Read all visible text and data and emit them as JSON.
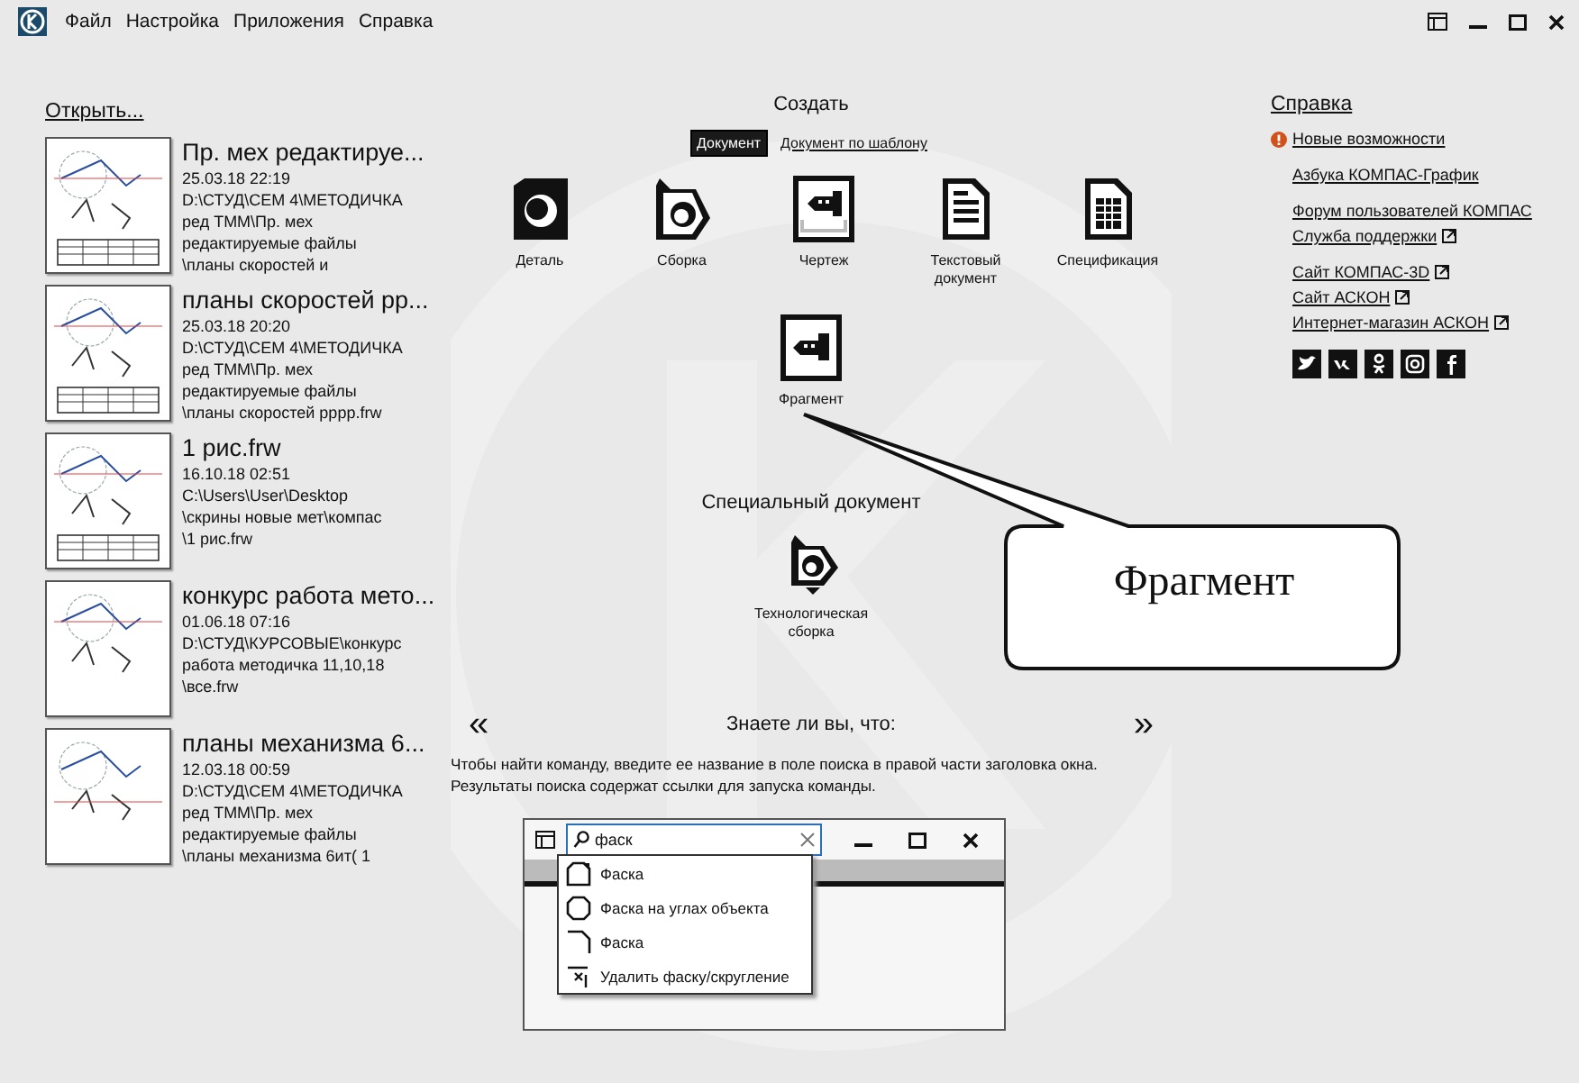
{
  "menu": [
    "Файл",
    "Настройка",
    "Приложения",
    "Справка"
  ],
  "recent": {
    "title": "Открыть...",
    "files": [
      {
        "name": "Пр. мех  редактируе...",
        "date": "25.03.18 22:19",
        "path": [
          "D:\\СТУД\\СЕМ 4\\МЕТОДИЧКА",
          "ред ТММ\\Пр. мех",
          "редактируемые файлы",
          "\\планы скоростей и"
        ]
      },
      {
        "name": "планы скоростей рр...",
        "date": "25.03.18 20:20",
        "path": [
          "D:\\СТУД\\СЕМ 4\\МЕТОДИЧКА",
          "ред ТММ\\Пр. мех",
          "редактируемые файлы",
          "\\планы скоростей рррр.frw"
        ]
      },
      {
        "name": "1 рис.frw",
        "date": "16.10.18 02:51",
        "path": [
          "C:\\Users\\User\\Desktop",
          "\\скрины новые мет\\компас",
          "\\1 рис.frw"
        ]
      },
      {
        "name": "конкурс работа мето...",
        "date": "01.06.18 07:16",
        "path": [
          "D:\\СТУД\\КУРСОВЫЕ\\конкурс",
          "работа методичка 11,10,18",
          "\\все.frw"
        ]
      },
      {
        "name": "планы механизма 6...",
        "date": "12.03.18 00:59",
        "path": [
          "D:\\СТУД\\СЕМ 4\\МЕТОДИЧКА",
          "ред ТММ\\Пр. мех",
          "редактируемые файлы",
          "\\планы механизма 6ит( 1"
        ]
      }
    ]
  },
  "create": {
    "title": "Создать",
    "modes": [
      {
        "label": "Документ",
        "selected": true
      },
      {
        "label": "Документ по шаблону",
        "selected": false
      }
    ],
    "documents": [
      {
        "kind": "part",
        "label": "Деталь"
      },
      {
        "kind": "assembly",
        "label": "Сборка"
      },
      {
        "kind": "drawing",
        "label": "Чертеж"
      },
      {
        "kind": "text",
        "label": "Текстовый документ"
      },
      {
        "kind": "spec",
        "label": "Спецификация"
      }
    ],
    "fragment": {
      "kind": "fragment",
      "label": "Фрагмент"
    }
  },
  "special": {
    "title": "Специальный документ",
    "items": [
      {
        "kind": "tech_assembly",
        "label": "Технологическая сборка"
      }
    ]
  },
  "tip": {
    "title": "Знаете ли вы, что:",
    "prev": "«",
    "next": "»",
    "lines": [
      "Чтобы найти команду, введите ее название в поле поиска в правой части заголовка окна.",
      "Результаты поиска содержат ссылки для запуска команды."
    ],
    "example": {
      "search": "фаск",
      "results": [
        {
          "kind": "chamfer",
          "label": "Фаска"
        },
        {
          "kind": "corners",
          "label": "Фаска на углах объекта"
        },
        {
          "kind": "edge",
          "label": "Фаска"
        },
        {
          "kind": "delete",
          "label": "Удалить фаску/скругление"
        }
      ]
    }
  },
  "help": {
    "title": "Справка",
    "groups": [
      [
        {
          "kind": "alert",
          "label": "Новые возможности"
        }
      ],
      [
        {
          "kind": "plain",
          "label": "Азбука КОМПАС-График"
        }
      ],
      [
        {
          "kind": "plain",
          "label": "Форум пользователей КОМПАС"
        },
        {
          "kind": "external",
          "label": "Служба поддержки"
        }
      ],
      [
        {
          "kind": "external",
          "label": "Сайт КОМПАС-3D"
        },
        {
          "kind": "external",
          "label": "Сайт АСКОН"
        },
        {
          "kind": "external",
          "label": "Интернет-магазин АСКОН"
        }
      ]
    ]
  },
  "callout": {
    "text": "Фрагмент"
  }
}
